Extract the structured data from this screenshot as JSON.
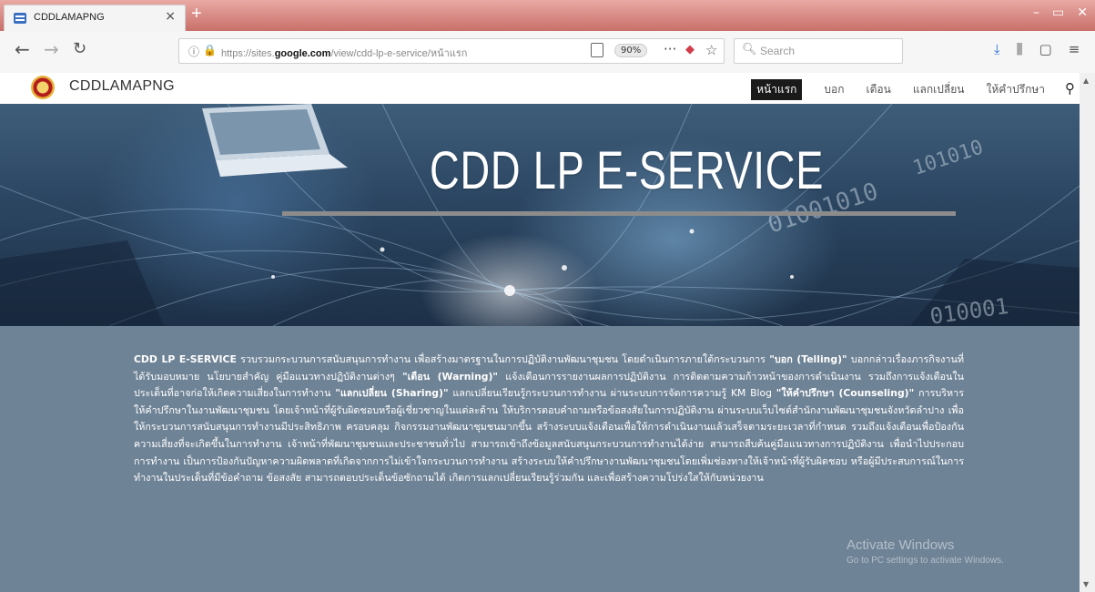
{
  "browser": {
    "tab_title": "CDDLAMAPNG",
    "tab_close": "×",
    "new_tab": "+",
    "url_prefix": "https://sites.",
    "url_domain": "google.com",
    "url_path": "/view/cdd-lp-e-service/หน้าแรก",
    "zoom": "90%",
    "more": "···",
    "search_placeholder": "Search",
    "icons": [
      "back-icon",
      "forward-icon",
      "reload-icon",
      "info-icon",
      "lock-icon",
      "reader-icon",
      "pocket-icon",
      "star-icon",
      "download-icon",
      "library-icon",
      "sidebar-icon",
      "menu-icon"
    ]
  },
  "site": {
    "name": "CDDLAMAPNG",
    "nav": [
      "หน้าแรก",
      "บอก",
      "เตือน",
      "แลกเปลี่ยน",
      "ให้คำปรึกษา"
    ],
    "active_nav": "หน้าแรก"
  },
  "hero": {
    "title": "CDD LP E-SERVICE",
    "binary_1": "01001010",
    "binary_2": "101010",
    "binary_3": "010001"
  },
  "body": {
    "lead": "CDD LP E-SERVICE",
    "p1": " รวบรวมกระบวนการสนับสนุนการทำงาน เพื่อสร้างมาตรฐานในการปฏิบัติงานพัฒนาชุมชน โดยดำเนินการภายใต้กระบวนการ ",
    "telling": "\"บอก (Telling)\"",
    "p2": " บอกกล่าวเรื่องภารกิจงานที่ได้รับมอบหมาย นโยบายสำคัญ คู่มือแนวทางปฏิบัติงานต่างๆ ",
    "warning": "\"เตือน (Warning)\"",
    "p3": " แจ้งเตือนการรายงานผลการปฏิบัติงาน การติดตามความก้าวหน้าของการดำเนินงาน รวมถึงการแจ้งเตือนในประเด็นที่อาจก่อให้เกิดความเสี่ยงในการทำงาน ",
    "sharing": "\"แลกเปลี่ยน (Sharing)\"",
    "p4": " แลกเปลี่ยนเรียนรู้กระบวนการทำงาน ผ่านระบบการจัดการความรู้ KM Blog ",
    "counseling": "\"ให้คำปรึกษา (Counseling)\"",
    "p5": " การบริหารให้คำปรึกษาในงานพัฒนาชุมชน โดยเจ้าหน้าที่ผู้รับผิดชอบหรือผู้เชี่ยวชาญในแต่ละด้าน ให้บริการตอบคำถามหรือข้อสงสัยในการปฏิบัติงาน ผ่านระบบเว็บไซต์สำนักงานพัฒนาชุมชนจังหวัดลำปาง เพื่อให้กระบวนการสนับสนุนการทำงานมีประสิทธิภาพ ครอบคลุม กิจกรรมงานพัฒนาชุมชนมากขึ้น สร้างระบบแจ้งเตือนเพื่อให้การดำเนินงานแล้วเสร็จตามระยะเวลาที่กำหนด รวมถึงแจ้งเตือนเพื่อป้องกันความเสี่ยงที่จะเกิดขึ้นในการทำงาน เจ้าหน้าที่พัฒนาชุมชนและประชาชนทั่วไป สามารถเข้าถึงข้อมูลสนับสนุนกระบวนการทำงานได้ง่าย สามารถสืบค้นคู่มือแนวทางการปฏิบัติงาน เพื่อนำไปประกอบการทำงาน เป็นการป้องกันปัญหาความผิดพลาดที่เกิดจากการไม่เข้าใจกระบวนการทำงาน สร้างระบบให้คำปรึกษางานพัฒนาชุมชนโดยเพิ่มช่องทางให้เจ้าหน้าที่ผู้รับผิดชอบ หรือผู้มีประสบการณ์ในการทำงานในประเด็นที่มีข้อคำถาม ข้อสงสัย สามารถตอบประเด็นข้อซักถามได้ เกิดการแลกเปลี่ยนเรียนรู้ร่วมกัน และเพื่อสร้างความโปร่งใสให้กับหน่วยงาน"
  },
  "overlay": {
    "activate_title": "Activate Windows",
    "activate_sub": "Go to PC settings to activate Windows."
  }
}
